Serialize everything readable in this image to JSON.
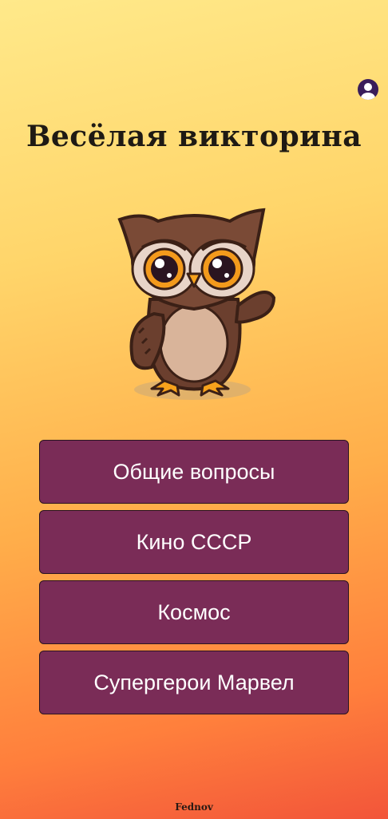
{
  "header": {
    "profile_icon": "account-circle-icon",
    "title": "Весёлая викторина"
  },
  "mascot": {
    "name": "owl-mascot"
  },
  "menu": {
    "items": [
      {
        "label": "Общие вопросы"
      },
      {
        "label": "Кино СССР"
      },
      {
        "label": "Космос"
      },
      {
        "label": "Супергерои Марвел"
      }
    ]
  },
  "footer": {
    "text": "Fednov"
  },
  "colors": {
    "button_bg": "#7a2c57",
    "button_text": "#ffffff",
    "title_text": "#1f1a14",
    "profile_icon": "#3a1d5a"
  }
}
